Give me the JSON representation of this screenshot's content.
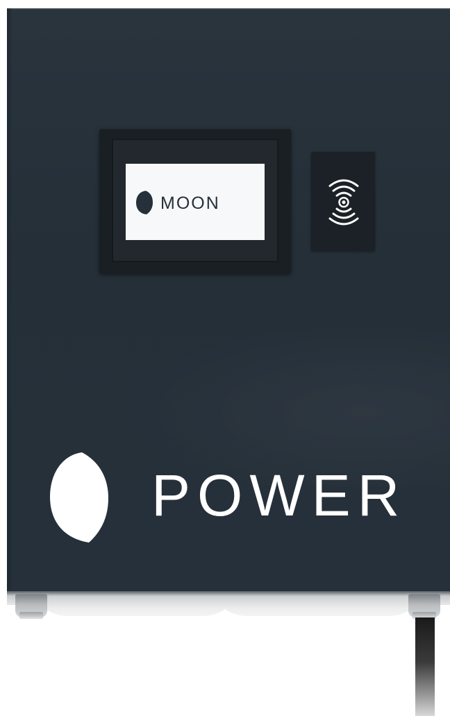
{
  "device": {
    "display": {
      "logo_text": "MOON",
      "logo_icon": "moon-crescent-icon"
    },
    "reader": {
      "icon": "contactless-rfid-icon"
    },
    "branding": {
      "text": "POWER",
      "icon": "moon-crescent-icon"
    }
  },
  "colors": {
    "cabinet": "#26303a",
    "screen_background": "#f7f8f9",
    "logo_dark": "#26303a",
    "brand_text": "#ffffff"
  }
}
